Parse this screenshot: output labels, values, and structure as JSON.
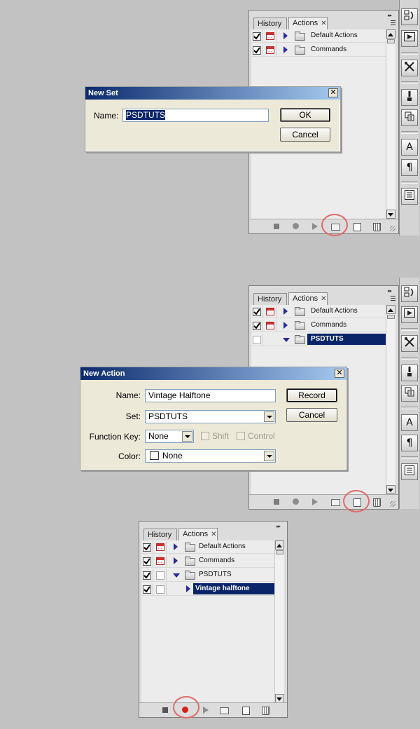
{
  "tabs": {
    "history": "History",
    "actions": "Actions"
  },
  "panel1": {
    "rows": [
      {
        "label": "Default Actions"
      },
      {
        "label": "Commands"
      }
    ]
  },
  "panel2": {
    "rows": [
      {
        "label": "Default Actions"
      },
      {
        "label": "Commands"
      },
      {
        "label": "PSDTUTS"
      }
    ]
  },
  "panel3": {
    "rows": [
      {
        "label": "Default Actions"
      },
      {
        "label": "Commands"
      },
      {
        "label": "PSDTUTS"
      },
      {
        "label": "Vintage halftone"
      }
    ]
  },
  "new_set_dialog": {
    "title": "New Set",
    "name_label": "Name:",
    "name_value": "PSDTUTS",
    "ok_label": "OK",
    "cancel_label": "Cancel",
    "close_glyph": "✕"
  },
  "new_action_dialog": {
    "title": "New Action",
    "name_label": "Name:",
    "name_value": "Vintage Halftone",
    "set_label": "Set:",
    "set_value": "PSDTUTS",
    "function_key_label": "Function Key:",
    "function_key_value": "None",
    "shift_label": "Shift",
    "control_label": "Control",
    "color_label": "Color:",
    "color_value": "None",
    "record_label": "Record",
    "cancel_label": "Cancel",
    "close_glyph": "✕"
  },
  "dock": {
    "icons": [
      "history-icon",
      "actions-icon",
      "tool-presets-icon",
      "brushes-icon",
      "clone-source-icon",
      "character-icon",
      "paragraph-icon",
      "layer-comps-icon"
    ],
    "glyphs": {
      "character": "A",
      "paragraph": "¶"
    }
  },
  "colors": {
    "selection": "#0a246a",
    "highlight_ring": "#e06a6a",
    "record_active": "#d6201a"
  }
}
